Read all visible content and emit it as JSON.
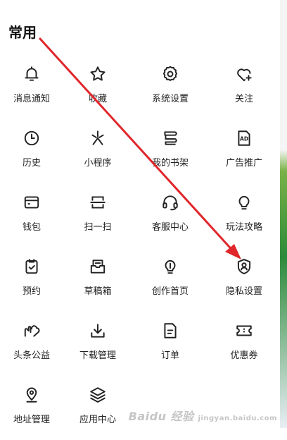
{
  "section": {
    "title": "常用"
  },
  "items": [
    {
      "label": "消息通知",
      "icon": "bell-icon"
    },
    {
      "label": "收藏",
      "icon": "star-icon"
    },
    {
      "label": "系统设置",
      "icon": "gear-icon"
    },
    {
      "label": "关注",
      "icon": "heart-plus-icon"
    },
    {
      "label": "历史",
      "icon": "clock-icon"
    },
    {
      "label": "小程序",
      "icon": "mini-program-icon"
    },
    {
      "label": "我的书架",
      "icon": "bookshelf-icon"
    },
    {
      "label": "广告推广",
      "icon": "ad-icon"
    },
    {
      "label": "钱包",
      "icon": "wallet-icon"
    },
    {
      "label": "扫一扫",
      "icon": "scan-icon"
    },
    {
      "label": "客服中心",
      "icon": "headset-icon"
    },
    {
      "label": "玩法攻略",
      "icon": "lightbulb-icon"
    },
    {
      "label": "预约",
      "icon": "clipboard-check-icon"
    },
    {
      "label": "草稿箱",
      "icon": "inbox-icon"
    },
    {
      "label": "创作首页",
      "icon": "bulb-pen-icon"
    },
    {
      "label": "隐私设置",
      "icon": "shield-user-icon"
    },
    {
      "label": "头条公益",
      "icon": "charity-hand-icon"
    },
    {
      "label": "下载管理",
      "icon": "download-icon"
    },
    {
      "label": "订单",
      "icon": "document-icon"
    },
    {
      "label": "优惠券",
      "icon": "ticket-icon"
    },
    {
      "label": "地址管理",
      "icon": "location-pin-icon"
    },
    {
      "label": "应用中心",
      "icon": "layers-icon"
    }
  ],
  "annotation": {
    "color": "#e0262b"
  },
  "watermark": {
    "text": "Baidu 经验",
    "sub": "jingyan.baidu.com"
  }
}
